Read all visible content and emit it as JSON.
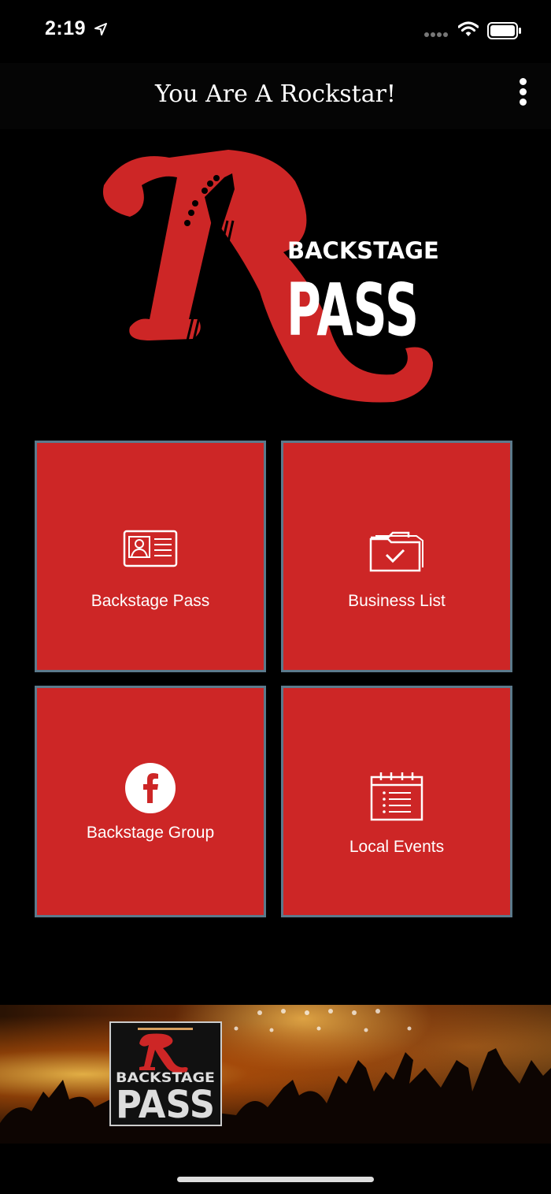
{
  "status_bar": {
    "time": "2:19"
  },
  "header": {
    "title": "You Are A Rockstar!"
  },
  "logo": {
    "line1": "BACKSTAGE",
    "line2": "PASS",
    "accent": "#cd2626"
  },
  "tiles": [
    {
      "label": "Backstage Pass",
      "icon": "id-card-icon"
    },
    {
      "label": "Business List",
      "icon": "folder-check-icon"
    },
    {
      "label": "Backstage Group",
      "icon": "facebook-icon"
    },
    {
      "label": "Local Events",
      "icon": "calendar-list-icon"
    }
  ],
  "banner": {
    "logo_line1": "BACKSTAGE",
    "logo_line2": "PASS"
  },
  "colors": {
    "tile_bg": "#cd2626",
    "tile_border": "#5b7a8c",
    "background": "#000000"
  }
}
